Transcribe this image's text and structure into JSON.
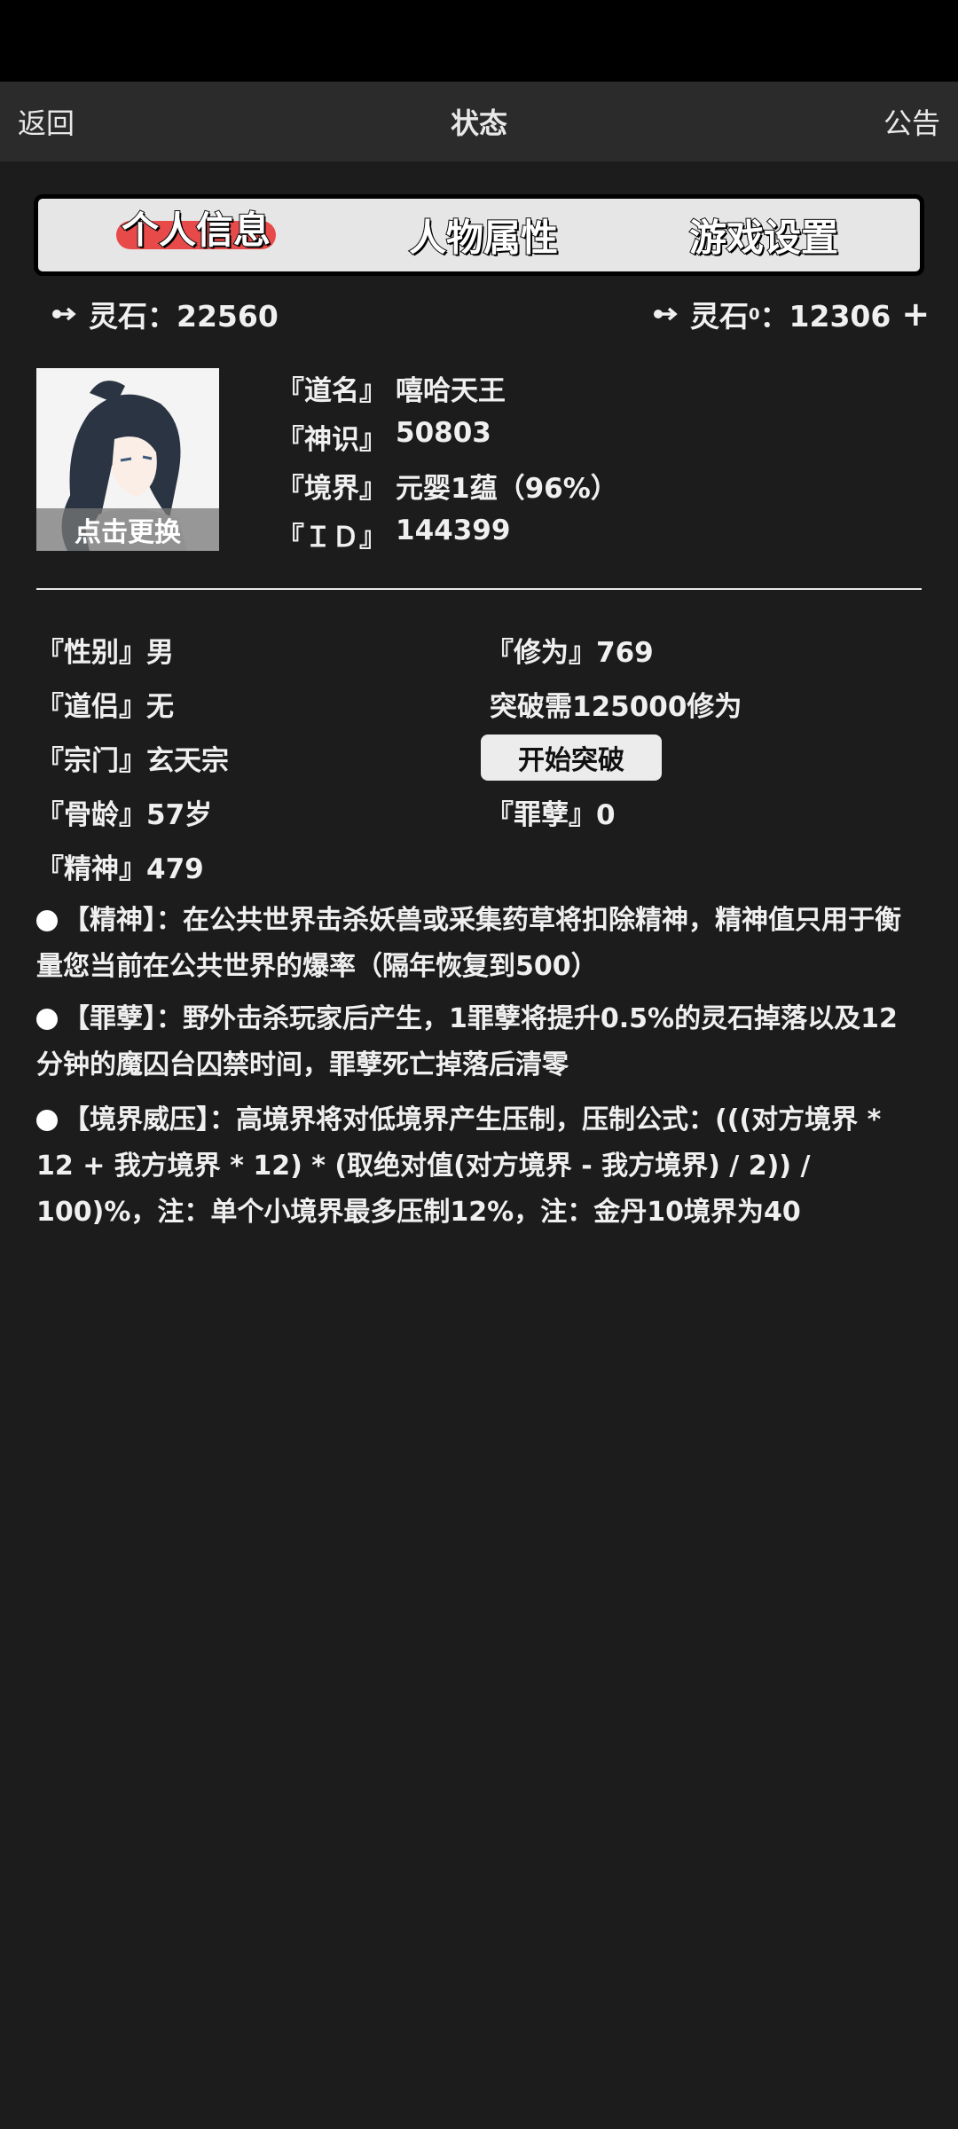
{
  "topbar": {
    "back": "返回",
    "title": "状态",
    "notice": "公告"
  },
  "tabs": [
    {
      "label": "个人信息",
      "active": true
    },
    {
      "label": "人物属性",
      "active": false
    },
    {
      "label": "游戏设置",
      "active": false
    }
  ],
  "currency": {
    "left_label": "灵石：22560",
    "right_label_prefix": "灵石",
    "right_label_sup": "0",
    "right_label_suffix": "：12306",
    "plus": "+"
  },
  "avatar": {
    "caption": "点击更换"
  },
  "profile": [
    {
      "key": "『道名』",
      "value": "嘻哈天王"
    },
    {
      "key": "『神识』",
      "value": "50803"
    },
    {
      "key": "『境界』",
      "value": "元婴1蕴（96%）"
    },
    {
      "key": "『ＩＤ』",
      "value": "144399"
    }
  ],
  "stats": {
    "gender": "『性别』男",
    "cultivation": "『修为』769",
    "partner": "『道侣』无",
    "breakthrough_req": "突破需125000修为",
    "sect": "『宗门』玄天宗",
    "breakthrough_button": "开始突破",
    "bone_age": "『骨龄』57岁",
    "sin": "『罪孽』0",
    "spirit": "『精神』479"
  },
  "notes": [
    "【精神】：在公共世界击杀妖兽或采集药草将扣除精神，精神值只用于衡量您当前在公共世界的爆率（隔年恢复到500）",
    "【罪孽】：野外击杀玩家后产生，1罪孽将提升0.5%的灵石掉落以及12分钟的魔囚台囚禁时间，罪孽死亡掉落后清零",
    "【境界威压】：高境界将对低境界产生压制，压制公式：(((对方境界 * 12 + 我方境界 * 12) * (取绝对值(对方境界 - 我方境界) / 2)) / 100)%，注：单个小境界最多压制12%，注：金丹10境界为40"
  ],
  "colors": {
    "tab_active_bg": "#e84a4a",
    "background": "#1c1c1c",
    "topbar": "#2b2b2b"
  }
}
